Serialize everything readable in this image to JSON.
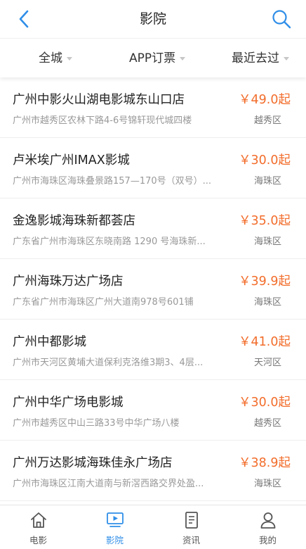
{
  "header": {
    "title": "影院"
  },
  "filters": [
    {
      "label": "全城"
    },
    {
      "label": "APP订票"
    },
    {
      "label": "最近去过"
    }
  ],
  "cinemas": [
    {
      "name": "广州中影火山湖电影城东山口店",
      "address": "广州市越秀区农林下路4-6号锦轩现代城四楼",
      "price": "￥49.0起",
      "district": "越秀区"
    },
    {
      "name": "卢米埃广州IMAX影城",
      "address": "广州市海珠区海珠叠景路157—170号（双号）...",
      "price": "￥30.0起",
      "district": "海珠区"
    },
    {
      "name": "金逸影城海珠新都荟店",
      "address": "广东省广州市海珠区东晓南路 1290 号海珠新...",
      "price": "￥35.0起",
      "district": "海珠区"
    },
    {
      "name": "广州海珠万达广场店",
      "address": "广东省广州市海珠区广州大道南978号601铺",
      "price": "￥39.9起",
      "district": "海珠区"
    },
    {
      "name": "广州中都影城",
      "address": "广州市天河区黄埔大道保利克洛维3期3、4层...",
      "price": "￥41.0起",
      "district": "天河区"
    },
    {
      "name": "广州中华广场电影城",
      "address": "广州市越秀区中山三路33号中华广场八楼",
      "price": "￥30.0起",
      "district": "越秀区"
    },
    {
      "name": "广州万达影城海珠佳永广场店",
      "address": "广州市海珠区江南大道南与新滘西路交界处盈...",
      "price": "￥38.9起",
      "district": "海珠区"
    }
  ],
  "tabbar": [
    {
      "label": "电影",
      "icon": "home-icon",
      "active": false
    },
    {
      "label": "影院",
      "icon": "screen-play-icon",
      "active": true
    },
    {
      "label": "资讯",
      "icon": "document-icon",
      "active": false
    },
    {
      "label": "我的",
      "icon": "user-icon",
      "active": false
    }
  ],
  "colors": {
    "accent": "#2f8ee8",
    "price": "#f26d2b"
  }
}
